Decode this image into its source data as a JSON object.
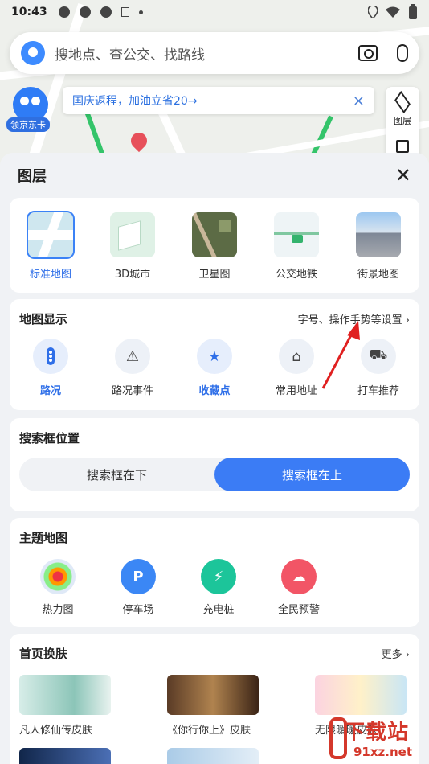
{
  "status_bar": {
    "time": "10:43",
    "signal_icons": [
      "app-icon",
      "app-icon",
      "app-icon",
      "a-icon",
      "dot"
    ],
    "right_icons": [
      "location-icon",
      "wifi-icon",
      "battery-icon"
    ]
  },
  "search": {
    "placeholder": "搜地点、查公交、找路线",
    "icons": [
      "camera-icon",
      "mic-icon"
    ]
  },
  "mascot": {
    "tag": "领京东卡"
  },
  "banner": {
    "text": "国庆返程，加油立省20→",
    "close": "×"
  },
  "layers_button": {
    "label": "图层"
  },
  "sheet": {
    "title": "图层",
    "close": "✕",
    "map_types": [
      {
        "label": "标准地图",
        "selected": true
      },
      {
        "label": "3D城市",
        "selected": false
      },
      {
        "label": "卫星图",
        "selected": false
      },
      {
        "label": "公交地铁",
        "selected": false
      },
      {
        "label": "街景地图",
        "selected": false
      }
    ],
    "map_display": {
      "title": "地图显示",
      "more": "字号、操作手势等设置 ›",
      "options": [
        {
          "label": "路况",
          "on": true,
          "icon": "traffic-light-icon"
        },
        {
          "label": "路况事件",
          "on": false,
          "icon": "traffic-event-icon"
        },
        {
          "label": "收藏点",
          "on": true,
          "icon": "star-icon"
        },
        {
          "label": "常用地址",
          "on": false,
          "icon": "home-icon"
        },
        {
          "label": "打车推荐",
          "on": false,
          "icon": "taxi-icon"
        }
      ]
    },
    "search_position": {
      "title": "搜索框位置",
      "options": [
        "搜索框在下",
        "搜索框在上"
      ],
      "selected": "搜索框在上"
    },
    "theme_maps": {
      "title": "主题地图",
      "items": [
        {
          "label": "热力图",
          "icon": "heatmap-icon"
        },
        {
          "label": "停车场",
          "icon": "parking-icon",
          "glyph": "P"
        },
        {
          "label": "充电桩",
          "icon": "charging-icon",
          "glyph": "⚡"
        },
        {
          "label": "全民预警",
          "icon": "alert-icon",
          "glyph": "☁"
        }
      ]
    },
    "skins": {
      "title": "首页换肤",
      "more": "更多 ›",
      "items": [
        {
          "label": "凡人修仙传皮肤"
        },
        {
          "label": "《你行你上》皮肤"
        },
        {
          "label": "无限暖暖皮肤"
        }
      ]
    }
  },
  "colors": {
    "accent": "#3b7cf5",
    "annotation_arrow": "#e02020"
  },
  "watermark": {
    "big": "下载站",
    "small": "91xz.net"
  }
}
